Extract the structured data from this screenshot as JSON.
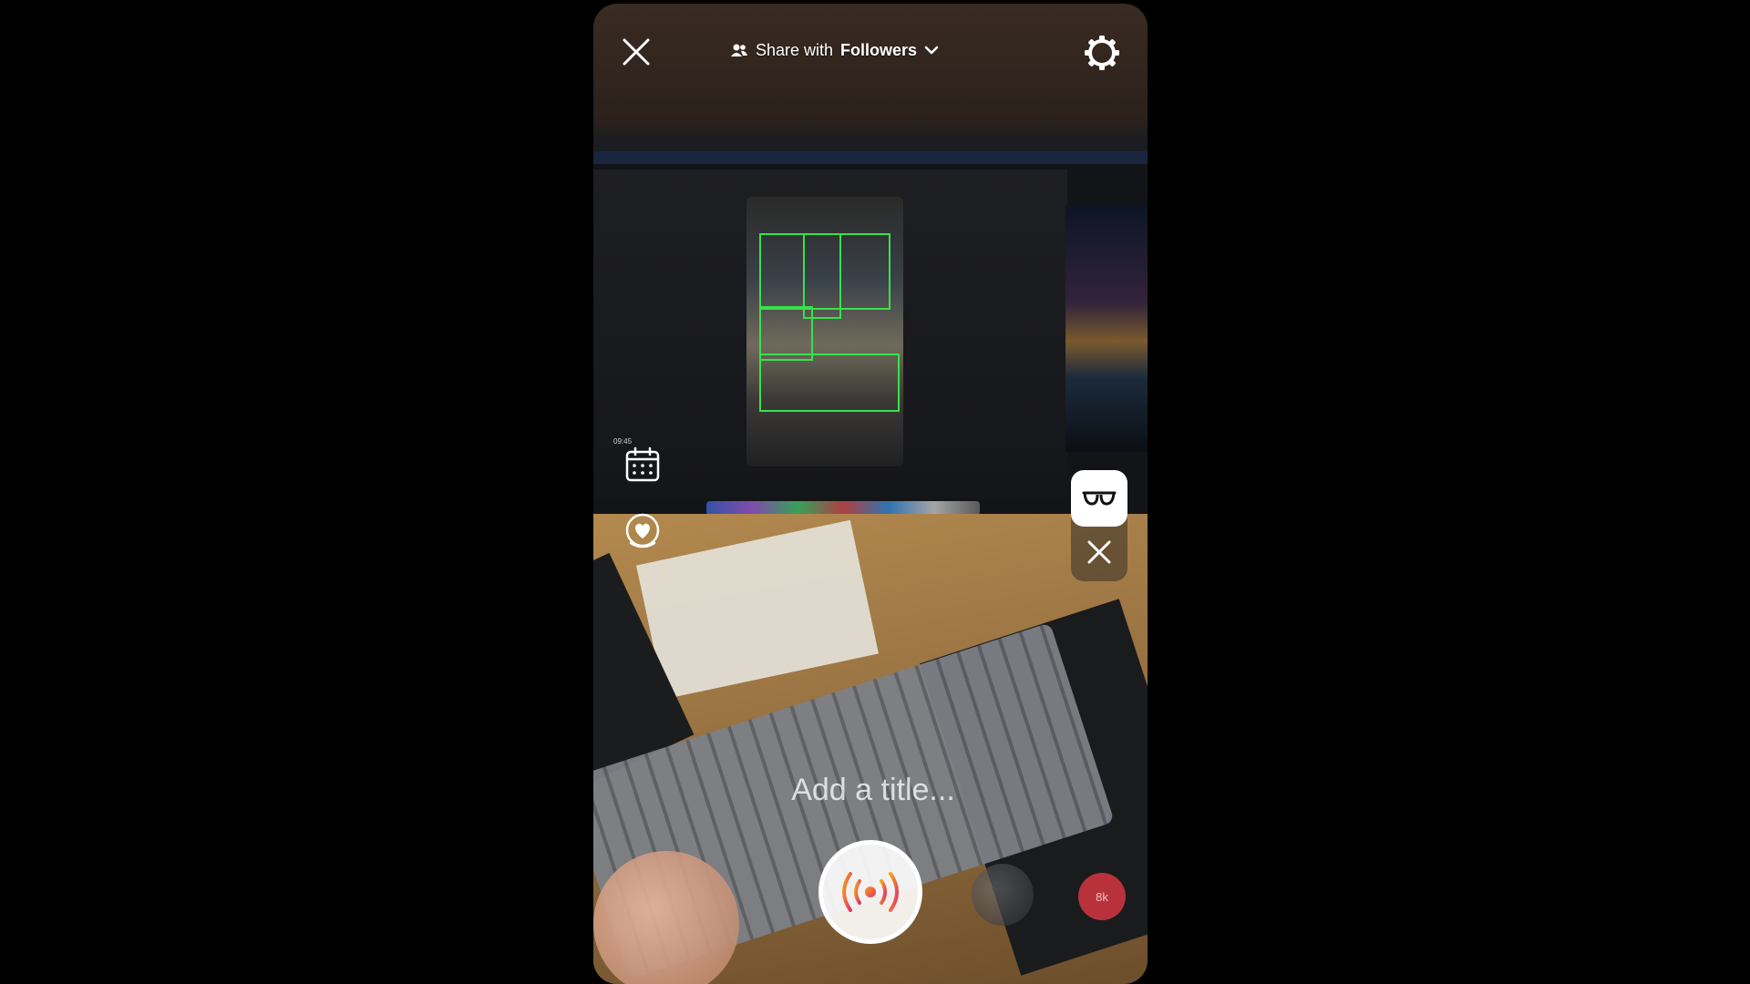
{
  "header": {
    "share_prefix": "Share with",
    "share_audience": "Followers"
  },
  "scene": {
    "timer_text": "09:45"
  },
  "composer": {
    "title_placeholder": "Add a title..."
  },
  "footer": {
    "viewer_count": "8k"
  },
  "icons": {
    "close": "close-icon",
    "settings": "gear-icon",
    "audience": "people-icon",
    "chevron": "chevron-down-icon",
    "calendar": "calendar-icon",
    "heart": "heart-bubble-icon",
    "glasses": "glasses-icon",
    "live": "live-broadcast-icon"
  },
  "colors": {
    "live_accent_start": "#f6a21a",
    "live_accent_end": "#e0336b",
    "badge": "#b8323c"
  }
}
